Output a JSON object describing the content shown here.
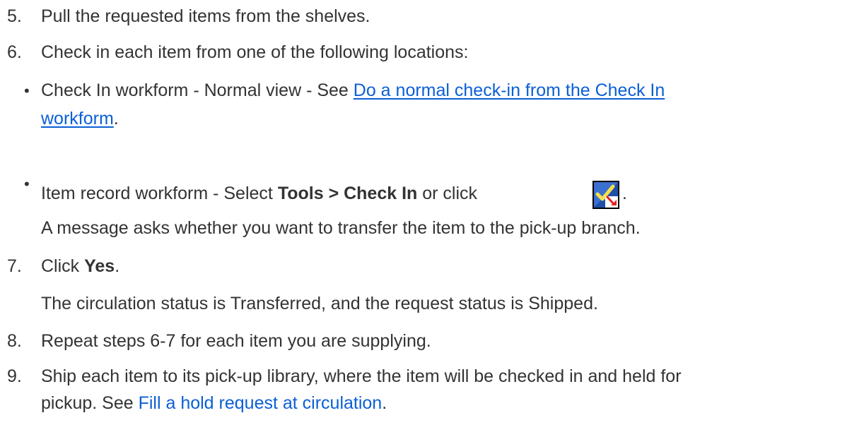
{
  "steps": {
    "s5": {
      "num": "5.",
      "text": "Pull the requested items from the shelves."
    },
    "s6": {
      "num": "6.",
      "text": "Check in each item from one of the following locations:"
    },
    "b1": {
      "bullet": "•",
      "prefix": "Check In workform - Normal view - See ",
      "link_line1": "Do a normal check-in from the Check In",
      "link_line2": "workform",
      "suffix": "."
    },
    "b2": {
      "bullet": "•",
      "prefix": "Item record workform - Select ",
      "bold": "Tools > Check In",
      "middle": " or click ",
      "icon": "check-in-icon",
      "suffix": "."
    },
    "b2_result": "A message asks whether you want to transfer the item to the pick-up branch.",
    "s7": {
      "num": "7.",
      "prefix": "Click ",
      "bold": "Yes",
      "suffix": "."
    },
    "s7_result": "The circulation status is Transferred, and the request status is Shipped.",
    "s8": {
      "num": "8.",
      "text": "Repeat steps 6-7 for each item you are supplying."
    },
    "s9": {
      "num": "9.",
      "line1": "Ship each item to its pick-up library, where the item will be checked in and held for",
      "line2_prefix": "pickup. See ",
      "link": "Fill a hold request at circulation",
      "suffix": "."
    }
  },
  "colors": {
    "text": "#333333",
    "link": "#0b5fd6"
  }
}
